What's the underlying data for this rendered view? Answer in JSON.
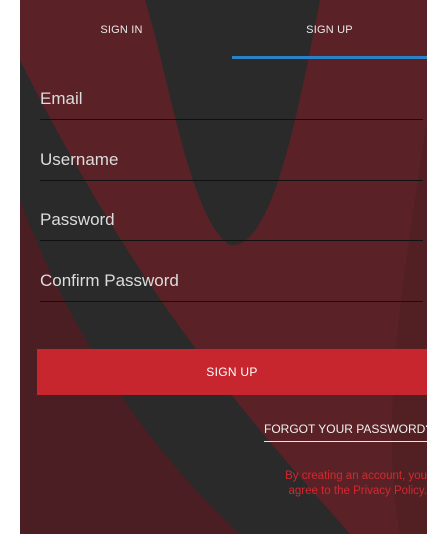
{
  "tabs": [
    {
      "label": "SIGN IN",
      "selected": false
    },
    {
      "label": "SIGN UP",
      "selected": true
    }
  ],
  "form": {
    "email_placeholder": "Email",
    "username_placeholder": "Username",
    "password_placeholder": "Password",
    "confirm_password_placeholder": "Confirm Password"
  },
  "actions": {
    "signup_label": "SIGN UP",
    "forgot_password_label": "FORGOT YOUR PASSWORD?"
  },
  "legal": {
    "line1": "By creating an account, you",
    "line2": "agree to the Privacy Policy."
  },
  "colors": {
    "background": "#2a2a2a",
    "accent_red": "#c8262e",
    "tab_indicator_blue": "#2a82c6",
    "bg_shape_red": "#5a2226"
  }
}
